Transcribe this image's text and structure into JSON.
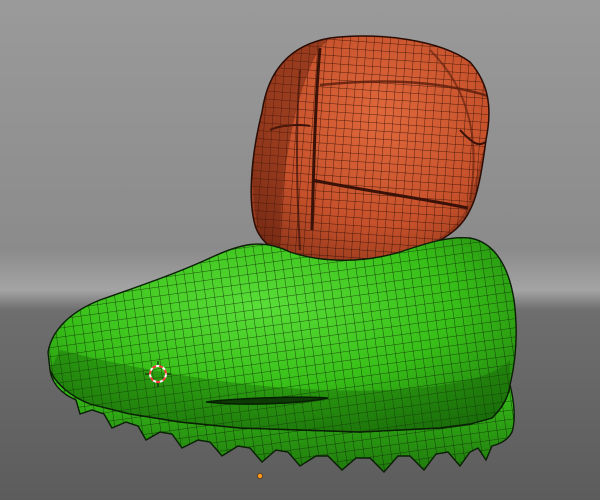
{
  "viewport": {
    "kind": "3d-viewport",
    "shading": "solid-with-wireframe-overlay",
    "colors": {
      "background_upper": "#8c8c8c",
      "background_lower": "#616161",
      "horizon_glow": "#a9a9a9",
      "wire": "#101010",
      "origin_dot": "#ff9a1f",
      "cursor_ring_a": "#ff3b3b",
      "cursor_ring_b": "#ffffff"
    }
  },
  "model": {
    "name_icon": "boot-mesh",
    "parts": [
      {
        "id": "upper",
        "material_color": "#c8532e",
        "shadow_color": "#7a2c16"
      },
      {
        "id": "sole",
        "material_color": "#38c018",
        "shadow_color": "#1d6e0a"
      }
    ]
  },
  "cursor": {
    "icon": "3d-cursor-icon"
  }
}
